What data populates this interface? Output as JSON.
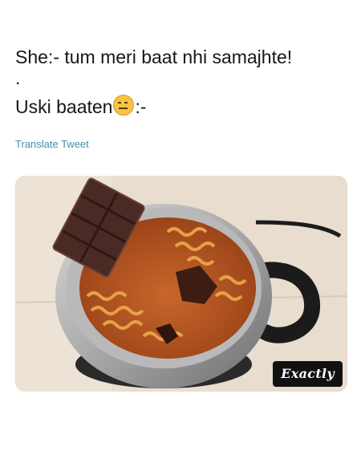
{
  "tweet": {
    "line1": "She:- tum meri baat nhi samajhte!",
    "dot": ".",
    "line2_before_emoji": "Uski baaten",
    "line2_after_emoji": ":-",
    "emoji": "expressionless-face-emoji",
    "translate_link": "Translate Tweet"
  },
  "media": {
    "caption": "Exactly",
    "colors": {
      "badge_bg": "#111111",
      "badge_text": "#ffffff",
      "link": "#3e8fa8"
    }
  }
}
